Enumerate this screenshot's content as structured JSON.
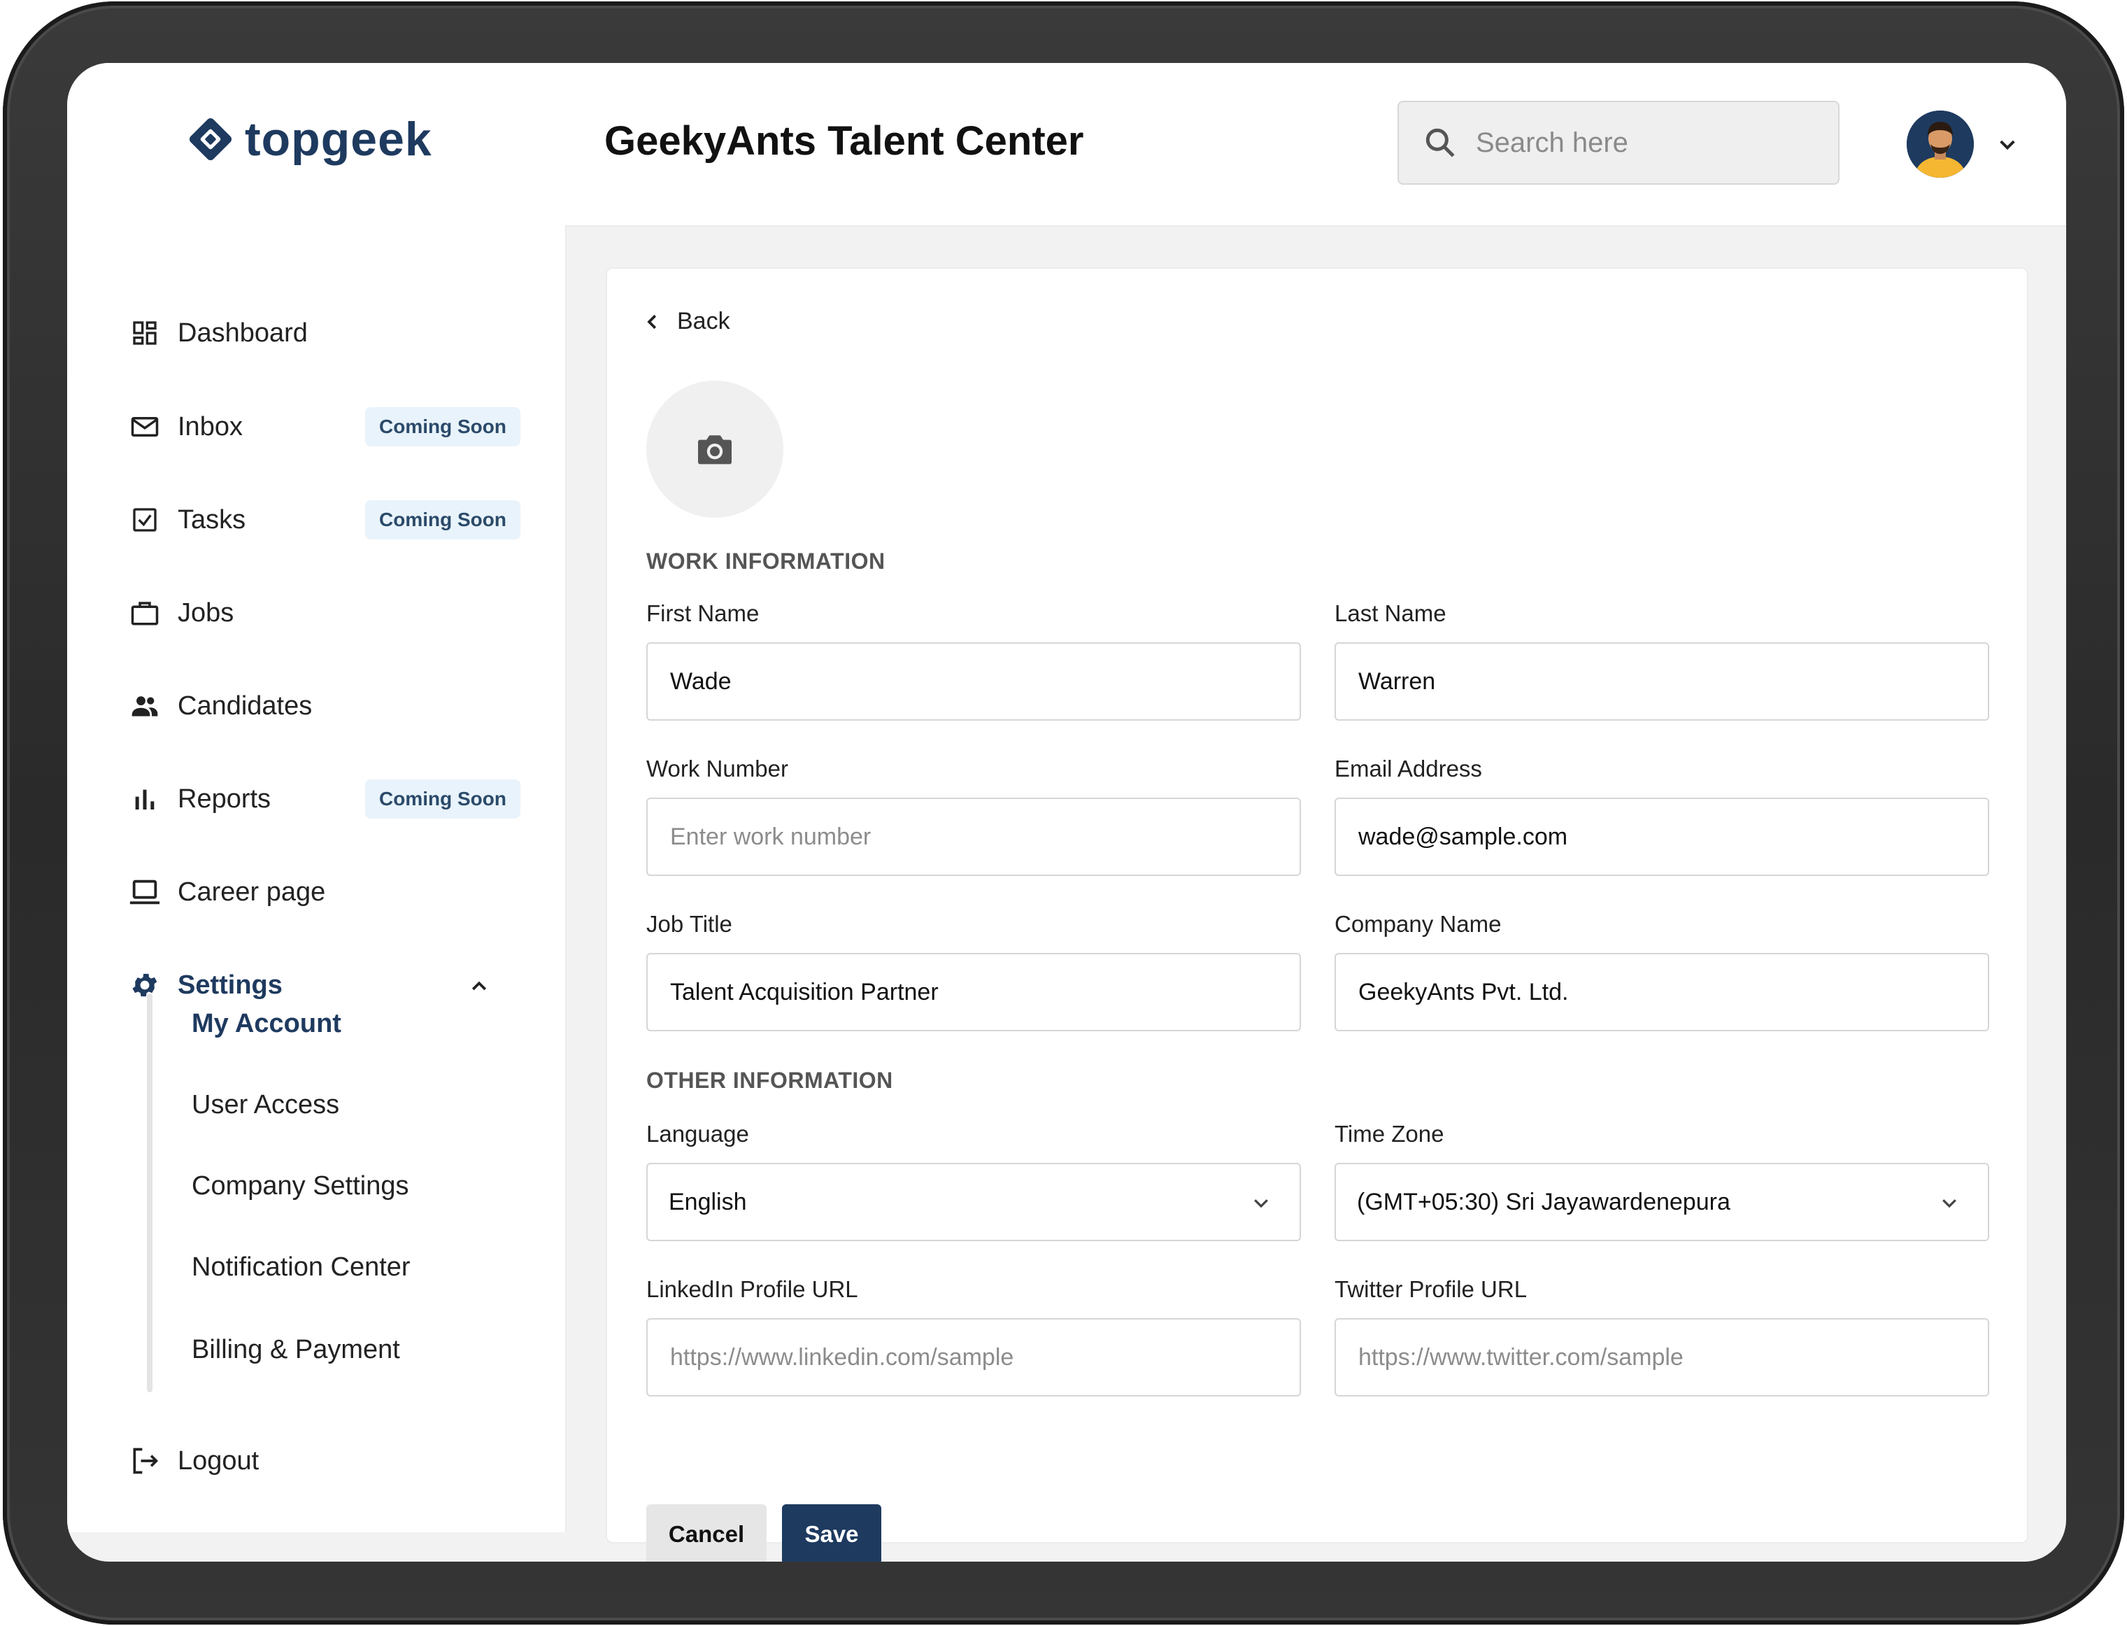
{
  "brand": {
    "name": "topgeek",
    "color": "#1e3a5f"
  },
  "header": {
    "title": "GeekyAnts Talent Center",
    "search_placeholder": "Search here"
  },
  "sidebar": {
    "items": [
      {
        "label": "Dashboard",
        "icon": "dashboard-icon",
        "badge": ""
      },
      {
        "label": "Inbox",
        "icon": "mail-icon",
        "badge": "Coming Soon"
      },
      {
        "label": "Tasks",
        "icon": "checkbox-icon",
        "badge": "Coming Soon"
      },
      {
        "label": "Jobs",
        "icon": "briefcase-icon",
        "badge": ""
      },
      {
        "label": "Candidates",
        "icon": "people-icon",
        "badge": ""
      },
      {
        "label": "Reports",
        "icon": "bar-chart-icon",
        "badge": "Coming Soon"
      },
      {
        "label": "Career page",
        "icon": "laptop-icon",
        "badge": ""
      }
    ],
    "settings": {
      "label": "Settings",
      "icon": "gear-icon",
      "expanded": true,
      "sub_items": [
        {
          "label": "My Account",
          "active": true
        },
        {
          "label": "User Access",
          "active": false
        },
        {
          "label": "Company Settings",
          "active": false
        },
        {
          "label": "Notification Center",
          "active": false
        },
        {
          "label": "Billing & Payment",
          "active": false
        }
      ]
    },
    "logout": {
      "label": "Logout",
      "icon": "logout-icon"
    }
  },
  "form": {
    "back_label": "Back",
    "work_section": "WORK INFORMATION",
    "other_section": "OTHER INFORMATION",
    "fields": {
      "first_name": {
        "label": "First Name",
        "value": "Wade",
        "placeholder": ""
      },
      "last_name": {
        "label": "Last Name",
        "value": "Warren",
        "placeholder": ""
      },
      "work_number": {
        "label": "Work Number",
        "value": "",
        "placeholder": "Enter work number"
      },
      "email": {
        "label": "Email Address",
        "value": "wade@sample.com",
        "placeholder": ""
      },
      "job_title": {
        "label": "Job Title",
        "value": "Talent Acquisition Partner",
        "placeholder": ""
      },
      "company_name": {
        "label": "Company Name",
        "value": "GeekyAnts Pvt. Ltd.",
        "placeholder": ""
      },
      "language": {
        "label": "Language",
        "value": "English"
      },
      "time_zone": {
        "label": "Time Zone",
        "value": "(GMT+05:30) Sri Jayawardenepura"
      },
      "linkedin": {
        "label": "LinkedIn Profile URL",
        "value": "",
        "placeholder": "https://www.linkedin.com/sample"
      },
      "twitter": {
        "label": "Twitter Profile URL",
        "value": "",
        "placeholder": "https://www.twitter.com/sample"
      }
    },
    "cancel_label": "Cancel",
    "save_label": "Save"
  },
  "colors": {
    "primary": "#1e3a5f",
    "badge_bg": "#e9f3fb",
    "content_bg": "#f2f2f2"
  }
}
